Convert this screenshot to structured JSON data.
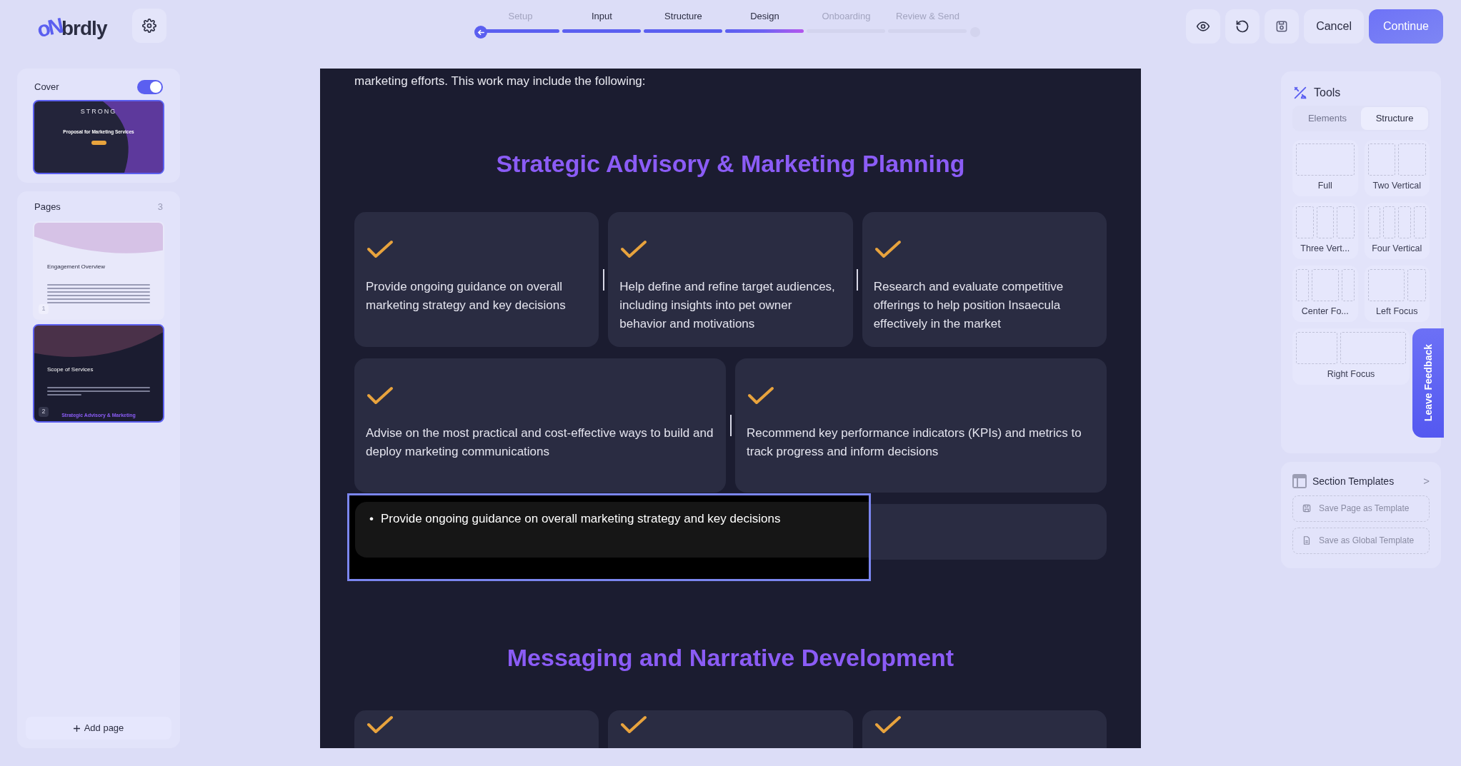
{
  "header": {
    "logo": {
      "mark": "oN",
      "text": "brdly"
    }
  },
  "steps": [
    {
      "label": "Setup",
      "complete": true,
      "current": false,
      "disabled": true
    },
    {
      "label": "Input",
      "complete": true,
      "current": false,
      "disabled": false
    },
    {
      "label": "Structure",
      "complete": true,
      "current": false,
      "disabled": false
    },
    {
      "label": "Design",
      "complete": false,
      "current": true,
      "disabled": false
    },
    {
      "label": "Onboarding",
      "complete": false,
      "current": false,
      "disabled": true
    },
    {
      "label": "Review & Send",
      "complete": false,
      "current": false,
      "disabled": true
    }
  ],
  "actions": {
    "cancel": "Cancel",
    "continue": "Continue"
  },
  "cover": {
    "label": "Cover",
    "on": true,
    "thumb": {
      "brand": "STRONG",
      "title": "Proposal for Marketing Services"
    }
  },
  "pages": {
    "label": "Pages",
    "count": "3",
    "add": "Add page",
    "items": [
      {
        "number": "1",
        "title": "Engagement Overview",
        "dark": false,
        "selected": false
      },
      {
        "number": "2",
        "title": "Scope of Services",
        "footer": "Strategic Advisory & Marketing",
        "dark": true,
        "selected": true
      }
    ]
  },
  "canvas": {
    "intro": "marketing efforts. This work may include the following:",
    "sections": [
      {
        "heading": "Strategic Advisory & Marketing Planning",
        "rows": [
          [
            {
              "text": "Provide ongoing guidance on overall marketing strategy and key decisions"
            },
            {
              "text": "Help define and refine target audiences, including insights into pet owner behavior and motivations"
            },
            {
              "text": "Research and evaluate competitive offerings to help position Insaecula effectively in the market"
            }
          ],
          [
            {
              "text": "Advise on the most practical and cost-effective ways to build and deploy marketing communications"
            },
            {
              "text": "Recommend key performance indicators (KPIs) and metrics to track progress and inform decisions"
            }
          ]
        ],
        "editing": {
          "marker": "•",
          "bullet": "Provide ongoing guidance on overall marketing strategy and key decisions"
        }
      },
      {
        "heading": "Messaging and Narrative Development",
        "rows": [
          [
            {
              "kind": "check"
            },
            {
              "kind": "check"
            },
            {
              "kind": "check"
            }
          ]
        ]
      }
    ]
  },
  "tools": {
    "title": "Tools",
    "tabs": [
      {
        "label": "Elements",
        "selected": false
      },
      {
        "label": "Structure",
        "selected": true
      }
    ],
    "layouts": [
      {
        "label": "Full",
        "kind": "full"
      },
      {
        "label": "Two Vertical",
        "kind": "two"
      },
      {
        "label": "Three Vert...",
        "kind": "three"
      },
      {
        "label": "Four Vertical",
        "kind": "four"
      },
      {
        "label": "Center Fo...",
        "kind": "center"
      },
      {
        "label": "Left Focus",
        "kind": "left"
      },
      {
        "label": "Right Focus",
        "kind": "right"
      }
    ]
  },
  "templates": {
    "title": "Section Templates",
    "arrow": ">",
    "buttons": [
      {
        "label": "Save Page as Template",
        "kind": "page"
      },
      {
        "label": "Save as Global Template",
        "kind": "global"
      }
    ]
  },
  "feedback": "Leave Feedback"
}
